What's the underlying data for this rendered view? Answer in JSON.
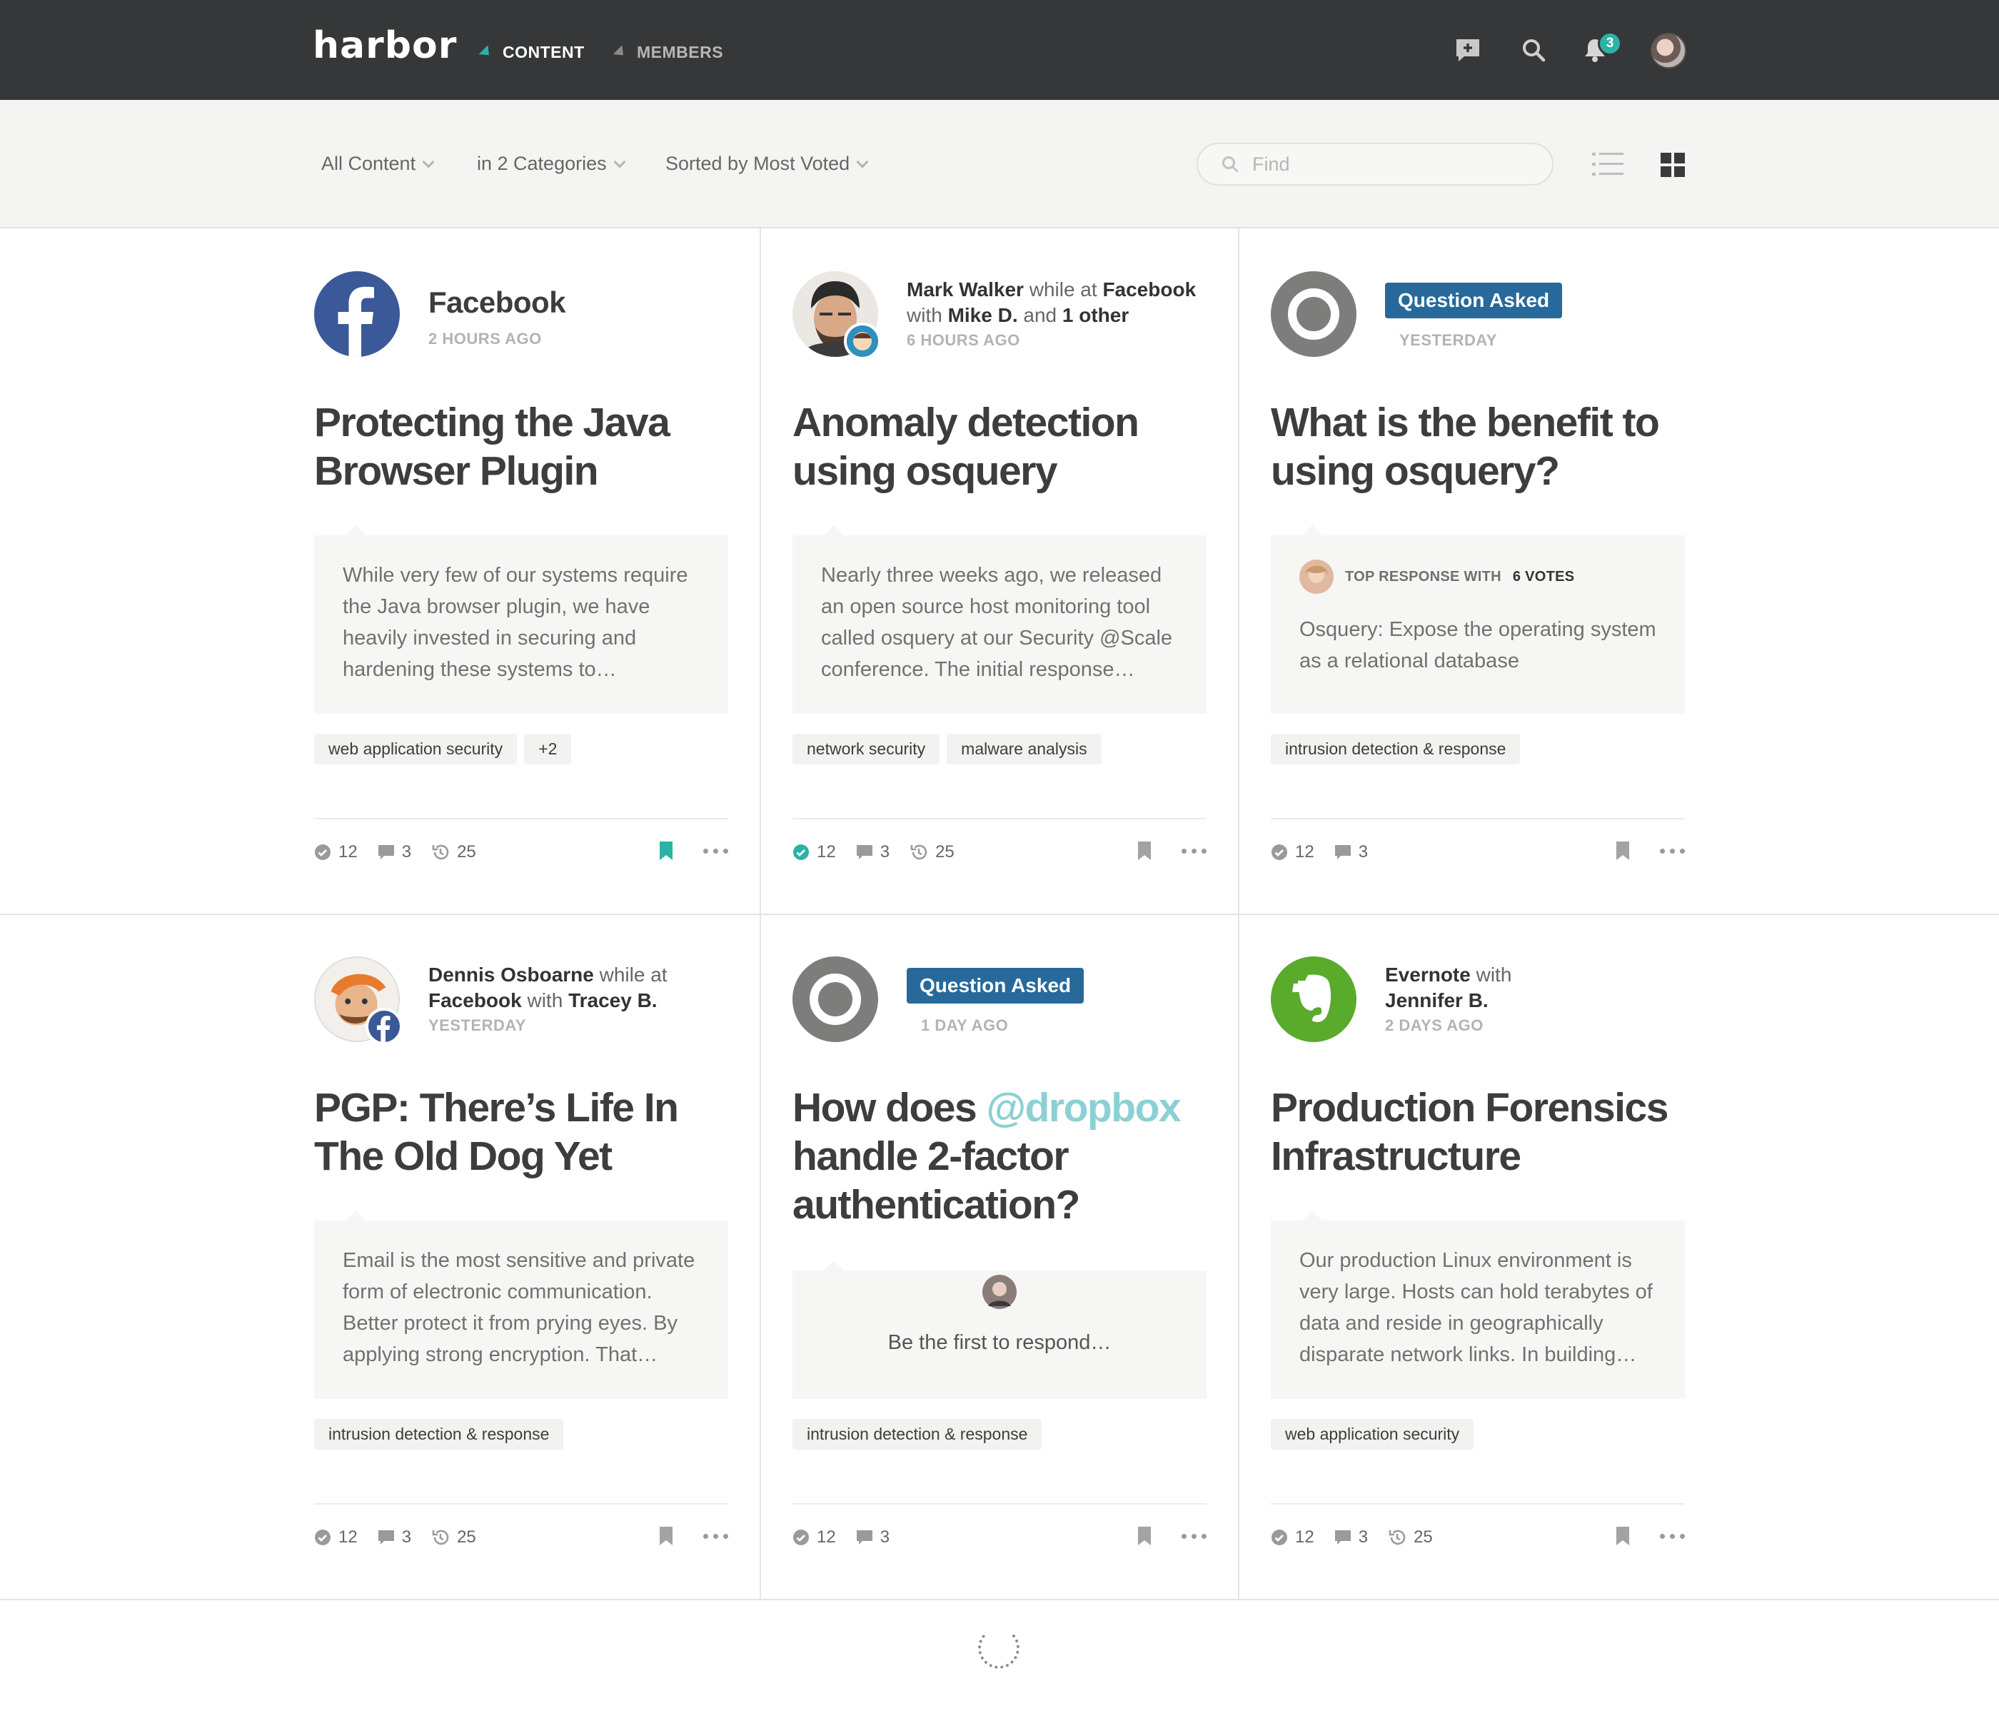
{
  "nav": {
    "logo": "harbor",
    "items": [
      {
        "label": "CONTENT",
        "active": true
      },
      {
        "label": "MEMBERS",
        "active": false
      }
    ],
    "notifications": "3"
  },
  "filters": {
    "scope": "All Content",
    "categories": "in 2 Categories",
    "sort": "Sorted by Most Voted",
    "search_placeholder": "Find"
  },
  "cards": [
    {
      "author": "Facebook",
      "time": "2 HOURS AGO",
      "title": "Protecting the Java Browser Plugin",
      "excerpt": "While very few of our systems require the Java browser plugin, we have heavily invested in securing and hardening these systems to…",
      "tags": [
        "web application security",
        "+2"
      ],
      "votes": "12",
      "comments": "3",
      "views": "25",
      "bookmarked": true
    },
    {
      "author": "Mark Walker",
      "while_at": "while at",
      "org": "Facebook",
      "with": "with",
      "co": "Mike D.",
      "and": "and",
      "others": "1 other",
      "time": "6 HOURS AGO",
      "title": "Anomaly detection using osquery",
      "excerpt": "Nearly three weeks ago, we released an open source host monitoring tool called osquery at our Security @Scale conference. The initial response…",
      "tags": [
        "network security",
        "malware analysis"
      ],
      "votes": "12",
      "comments": "3",
      "views": "25",
      "bookmarked": false
    },
    {
      "badge": "Question Asked",
      "time": "YESTERDAY",
      "title": "What is the benefit to using osquery?",
      "top_response_label": "TOP RESPONSE WITH",
      "top_response_votes": "6 VOTES",
      "excerpt": "Osquery: Expose the operating system as a relational database",
      "tags": [
        "intrusion detection & response"
      ],
      "votes": "12",
      "comments": "3",
      "bookmarked": false
    },
    {
      "author": "Dennis Osboarne",
      "while_at": "while at",
      "org": "Facebook",
      "with": "with",
      "co": "Tracey B.",
      "time": "YESTERDAY",
      "title": "PGP: There’s Life In The Old Dog Yet",
      "excerpt": "Email is the most sensitive and private form of electronic communication. Better protect it from prying eyes. By applying strong encryption. That…",
      "tags": [
        "intrusion detection & response"
      ],
      "votes": "12",
      "comments": "3",
      "views": "25",
      "bookmarked": false
    },
    {
      "badge": "Question Asked",
      "time": "1 DAY AGO",
      "title_pre": "How does ",
      "title_mention": "@dropbox",
      "title_post": " handle 2-factor authentication?",
      "respond": "Be the first to respond…",
      "tags": [
        "intrusion detection & response"
      ],
      "votes": "12",
      "comments": "3",
      "bookmarked": false
    },
    {
      "author": "Evernote",
      "with": "with",
      "co": "Jennifer B.",
      "time": "2 DAYS AGO",
      "title": "Production Forensics Infrastructure",
      "excerpt": "Our production Linux environment is very large. Hosts can hold terabytes of data and reside in geographically disparate network links. In building…",
      "tags": [
        "web application security"
      ],
      "votes": "12",
      "comments": "3",
      "views": "25",
      "bookmarked": false
    }
  ],
  "colors": {
    "topbar": "#363738",
    "accent": "#2ab3a6",
    "question_badge": "#27699a",
    "facebook": "#3b5998",
    "evernote": "#5aaa2c",
    "mention": "#8cd0d4"
  },
  "icons": [
    "add-post-icon",
    "search-icon",
    "bell-icon",
    "list-view-icon",
    "grid-view-icon",
    "check-circle-icon",
    "comment-icon",
    "history-icon",
    "bookmark-icon",
    "more-icon",
    "lifebuoy-icon",
    "facebook-logo",
    "evernote-logo",
    "loading-spinner"
  ]
}
